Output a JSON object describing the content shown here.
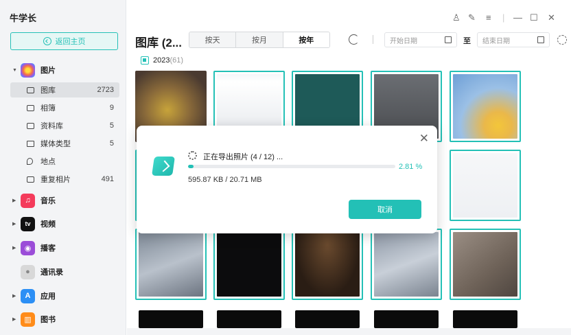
{
  "app": {
    "title": "牛学长"
  },
  "sidebar": {
    "home_label": "返回主页",
    "groups": [
      {
        "label": "图片",
        "icon": "photos-icon",
        "color": "#f7b733"
      },
      {
        "label": "音乐",
        "icon": "music-icon",
        "color": "#f43b5b"
      },
      {
        "label": "视频",
        "icon": "appletv-icon",
        "color": "#111111",
        "icon_text": "tv"
      },
      {
        "label": "播客",
        "icon": "podcast-icon",
        "color": "#9b4dd8"
      },
      {
        "label": "通讯录",
        "icon": "contacts-icon",
        "color": "#d8d8d8"
      },
      {
        "label": "应用",
        "icon": "appstore-icon",
        "color": "#2c8ff5"
      },
      {
        "label": "图书",
        "icon": "books-icon",
        "color": "#ff8c1a"
      }
    ],
    "photo_items": [
      {
        "label": "图库",
        "count": "2723",
        "active": true,
        "icon": "library-icon"
      },
      {
        "label": "相簿",
        "count": "9",
        "icon": "album-icon"
      },
      {
        "label": "资料库",
        "count": "5",
        "icon": "database-icon"
      },
      {
        "label": "媒体类型",
        "count": "5",
        "icon": "media-type-icon"
      },
      {
        "label": "地点",
        "count": "",
        "icon": "location-icon"
      },
      {
        "label": "重复相片",
        "count": "491",
        "icon": "duplicate-icon"
      }
    ]
  },
  "toolbar": {
    "title": "图库 (2...",
    "tabs": [
      {
        "label": "按天",
        "active": false
      },
      {
        "label": "按月",
        "active": false
      },
      {
        "label": "按年",
        "active": true
      }
    ],
    "start_date_placeholder": "开始日期",
    "to_label": "至",
    "end_date_placeholder": "结束日期"
  },
  "content": {
    "year": "2023",
    "year_count": "(61)"
  },
  "dialog": {
    "status_text": "正在导出照片 (4 / 12) ...",
    "progress_fraction": 0.0281,
    "percent_text": "2.81 %",
    "size_text": "595.87 KB / 20.71 MB",
    "cancel_label": "取消"
  },
  "colors": {
    "accent": "#23c0b6"
  }
}
